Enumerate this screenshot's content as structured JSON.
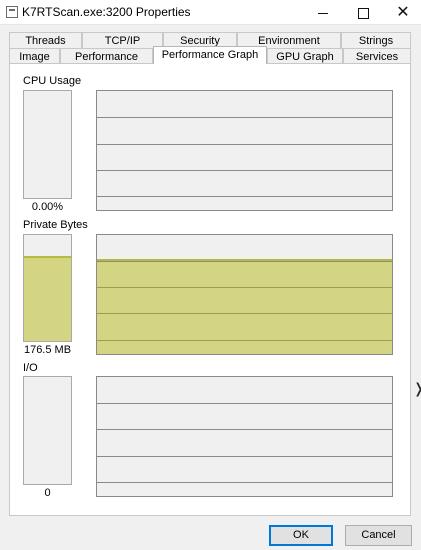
{
  "window": {
    "title": "K7RTScan.exe:3200 Properties",
    "close_glyph": "✕"
  },
  "tabs": {
    "row_back": [
      "Threads",
      "TCP/IP",
      "Security",
      "Environment",
      "Strings"
    ],
    "row_front": [
      "Image",
      "Performance",
      "Performance Graph",
      "GPU Graph",
      "Services"
    ],
    "active": "Performance Graph"
  },
  "sections": {
    "cpu": {
      "label": "CPU Usage",
      "value": "0.00%",
      "meter_fraction": 0.0
    },
    "private_bytes": {
      "label": "Private Bytes",
      "value": "176.5 MB",
      "meter_fraction": 0.8,
      "graph_fraction": 0.8
    },
    "io": {
      "label": "I/O",
      "value": "0",
      "meter_fraction": 0.0
    }
  },
  "buttons": {
    "ok": "OK",
    "cancel": "Cancel"
  },
  "icons": {
    "app": "window-icon",
    "minimize": "minimize-icon",
    "maximize": "maximize-icon",
    "close": "close-icon",
    "cursor": "resize-cursor-icon"
  },
  "colors": {
    "fill": "#d3d583",
    "fill_edge": "#b7ba3a",
    "grid": "#8a8a8a"
  }
}
